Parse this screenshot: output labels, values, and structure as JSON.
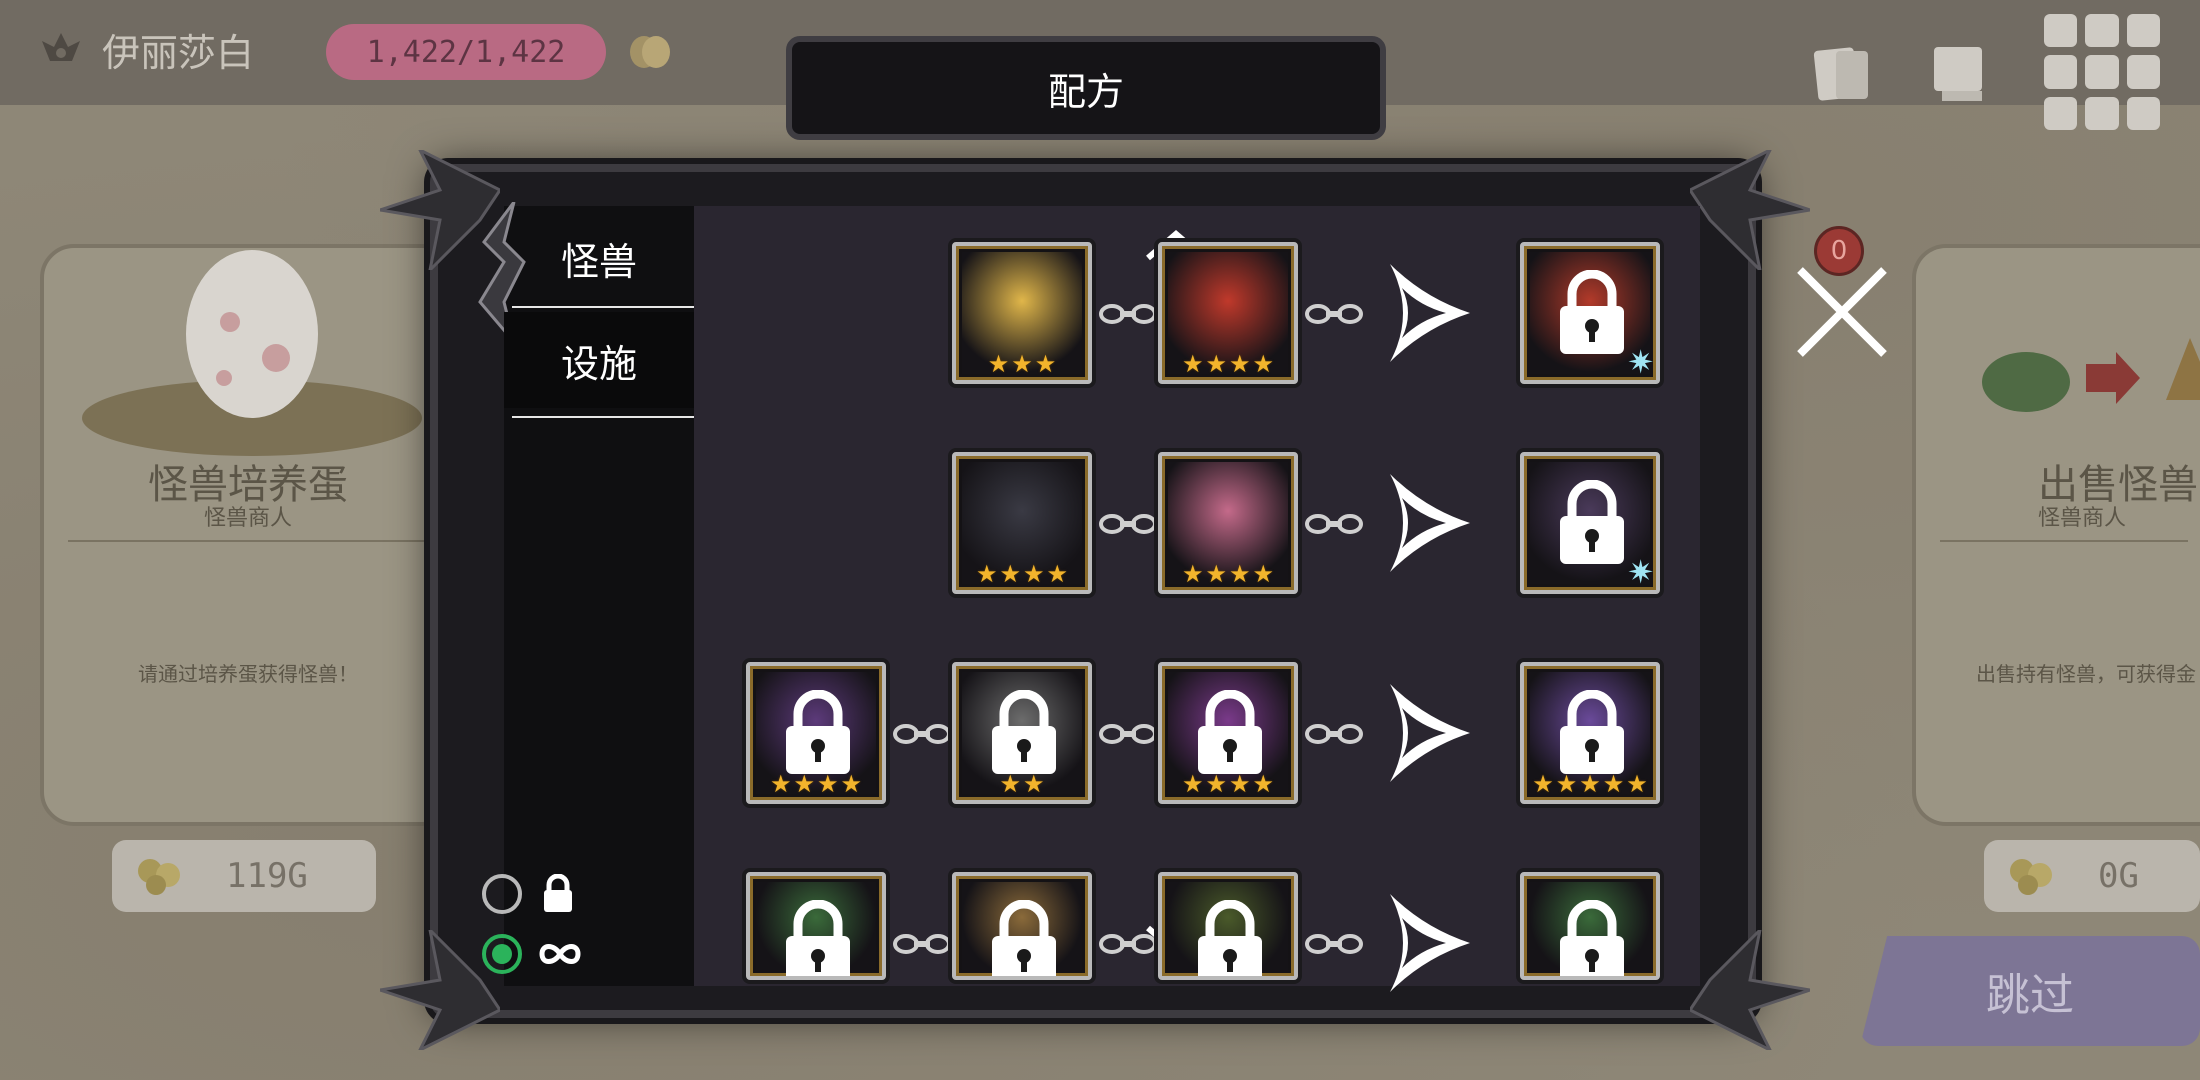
{
  "player": {
    "name": "伊丽莎白",
    "hp": "1,422/1,422"
  },
  "modal": {
    "title": "配方",
    "tabs": [
      {
        "label": "怪兽",
        "active": true
      },
      {
        "label": "设施",
        "active": false
      }
    ],
    "close_badge": "0",
    "filters": [
      {
        "name": "locked",
        "icon": "lock-icon",
        "selected": false
      },
      {
        "name": "infinite",
        "icon": "infinity-icon",
        "selected": true
      }
    ]
  },
  "background": {
    "left_card": {
      "title": "怪兽培养蛋",
      "subtitle": "怪兽商人",
      "description": "请通过培养蛋获得怪兽！",
      "price": "119G"
    },
    "right_card": {
      "title": "出售怪兽",
      "subtitle": "怪兽商人",
      "description": "出售持有怪兽，可获得金",
      "price": "0G"
    },
    "skip_label": "跳过"
  },
  "recipes": [
    {
      "ingredients": [
        {
          "monster": "rose-girl",
          "locked": false,
          "stars": 3,
          "accent": "#e0b64a"
        },
        {
          "monster": "red-ogre",
          "locked": false,
          "stars": 4,
          "accent": "#c0392b"
        }
      ],
      "result": {
        "locked": true,
        "stars": 0,
        "crystal": true,
        "accent": "#b23a2a"
      }
    },
    {
      "ingredients": [
        {
          "monster": "skeleton-reaper",
          "locked": false,
          "stars": 4,
          "accent": "#3a3a44"
        },
        {
          "monster": "pink-haired-girl",
          "locked": false,
          "stars": 4,
          "accent": "#c46a8a"
        }
      ],
      "result": {
        "locked": true,
        "stars": 0,
        "crystal": true,
        "accent": "#4a3a5a"
      }
    },
    {
      "ingredients": [
        {
          "monster": "purple-wisp",
          "locked": true,
          "stars": 4,
          "accent": "#5c3a7a"
        },
        {
          "monster": "bone-beast",
          "locked": true,
          "stars": 2,
          "accent": "#6c6c6c"
        },
        {
          "monster": "purple-witch",
          "locked": true,
          "stars": 4,
          "accent": "#7a3a8a"
        }
      ],
      "result": {
        "locked": true,
        "stars": 5,
        "crystal": false,
        "accent": "#6a4a9a"
      }
    },
    {
      "ingredients": [
        {
          "monster": "green-wisp",
          "locked": true,
          "stars": 0,
          "accent": "#3a6a3a"
        },
        {
          "monster": "goblin",
          "locked": true,
          "stars": 0,
          "accent": "#8a6a3a"
        },
        {
          "monster": "forest-beast",
          "locked": true,
          "stars": 0,
          "accent": "#4a5a2a"
        }
      ],
      "result": {
        "locked": true,
        "stars": 0,
        "crystal": false,
        "accent": "#3a6a3a"
      }
    }
  ]
}
